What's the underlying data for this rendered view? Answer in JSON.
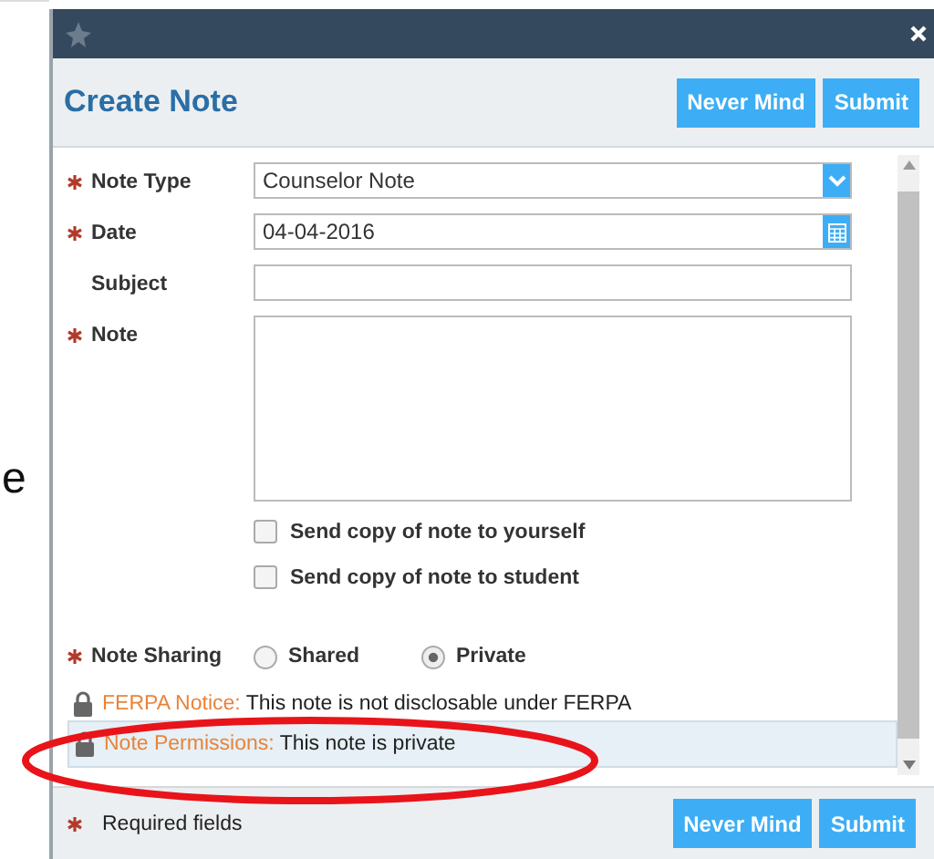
{
  "background_text": "e",
  "dialog": {
    "title": "Create Note",
    "header_buttons": [
      "Never Mind",
      "Submit"
    ]
  },
  "fields": [
    {
      "kind": "select",
      "label": "Note Type",
      "required": true,
      "value": "Counselor Note"
    },
    {
      "kind": "date",
      "label": "Date",
      "required": true,
      "value": "04-04-2016"
    },
    {
      "kind": "text",
      "label": "Subject",
      "required": false
    },
    {
      "kind": "textarea",
      "label": "Note",
      "required": true
    }
  ],
  "checkboxes": [
    {
      "label": "Send copy of note to yourself",
      "checked": false
    },
    {
      "label": "Send copy of note to student",
      "checked": false
    }
  ],
  "sharing": {
    "label": "Note Sharing",
    "required": true,
    "options": [
      {
        "label": "Shared",
        "selected": false
      },
      {
        "label": "Private",
        "selected": true
      }
    ]
  },
  "notices": [
    {
      "title": "FERPA Notice:",
      "text": "This note is not disclosable under FERPA",
      "highlighted": false
    },
    {
      "title": "Note Permissions:",
      "text": "This note is private",
      "highlighted": true
    }
  ],
  "footer": {
    "required_text": "Required fields",
    "buttons": [
      "Never Mind",
      "Submit"
    ]
  }
}
